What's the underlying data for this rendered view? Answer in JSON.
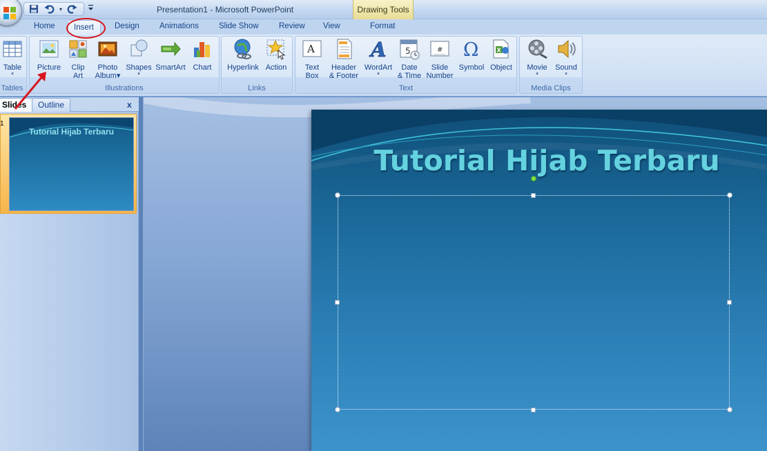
{
  "window": {
    "title": "Presentation1 - Microsoft PowerPoint",
    "contextual_tab": "Drawing Tools"
  },
  "quick_access": {
    "icons": [
      "save-icon",
      "undo-icon",
      "redo-icon",
      "customize-qat-icon"
    ]
  },
  "tabs": [
    {
      "label": "Home"
    },
    {
      "label": "Insert",
      "active": true
    },
    {
      "label": "Design"
    },
    {
      "label": "Animations"
    },
    {
      "label": "Slide Show"
    },
    {
      "label": "Review"
    },
    {
      "label": "View"
    },
    {
      "label": "Format"
    }
  ],
  "ribbon": {
    "groups": {
      "tables": "Tables",
      "illustrations": "Illustrations",
      "links": "Links",
      "text": "Text",
      "media": "Media Clips"
    },
    "buttons": {
      "table": "Table",
      "picture": "Picture",
      "clip_art_1": "Clip",
      "clip_art_2": "Art",
      "photo_album_1": "Photo",
      "photo_album_2": "Album",
      "shapes": "Shapes",
      "smartart": "SmartArt",
      "chart": "Chart",
      "hyperlink": "Hyperlink",
      "action": "Action",
      "text_box_1": "Text",
      "text_box_2": "Box",
      "header_footer_1": "Header",
      "header_footer_2": "& Footer",
      "wordart": "WordArt",
      "date_time_1": "Date",
      "date_time_2": "& Time",
      "slide_number_1": "Slide",
      "slide_number_2": "Number",
      "symbol": "Symbol",
      "object": "Object",
      "movie": "Movie",
      "sound": "Sound"
    },
    "dropdown_glyph": "▾"
  },
  "left_pane": {
    "tabs": {
      "slides": "Slides",
      "outline": "Outline"
    },
    "close": "x",
    "thumbnail": {
      "number": "1",
      "title": "Tutorial Hijab Terbaru"
    }
  },
  "slide": {
    "title": "Tutorial Hijab Terbaru"
  },
  "colors": {
    "annotation_red": "#d8151c",
    "slide_title": "#64d2df"
  }
}
